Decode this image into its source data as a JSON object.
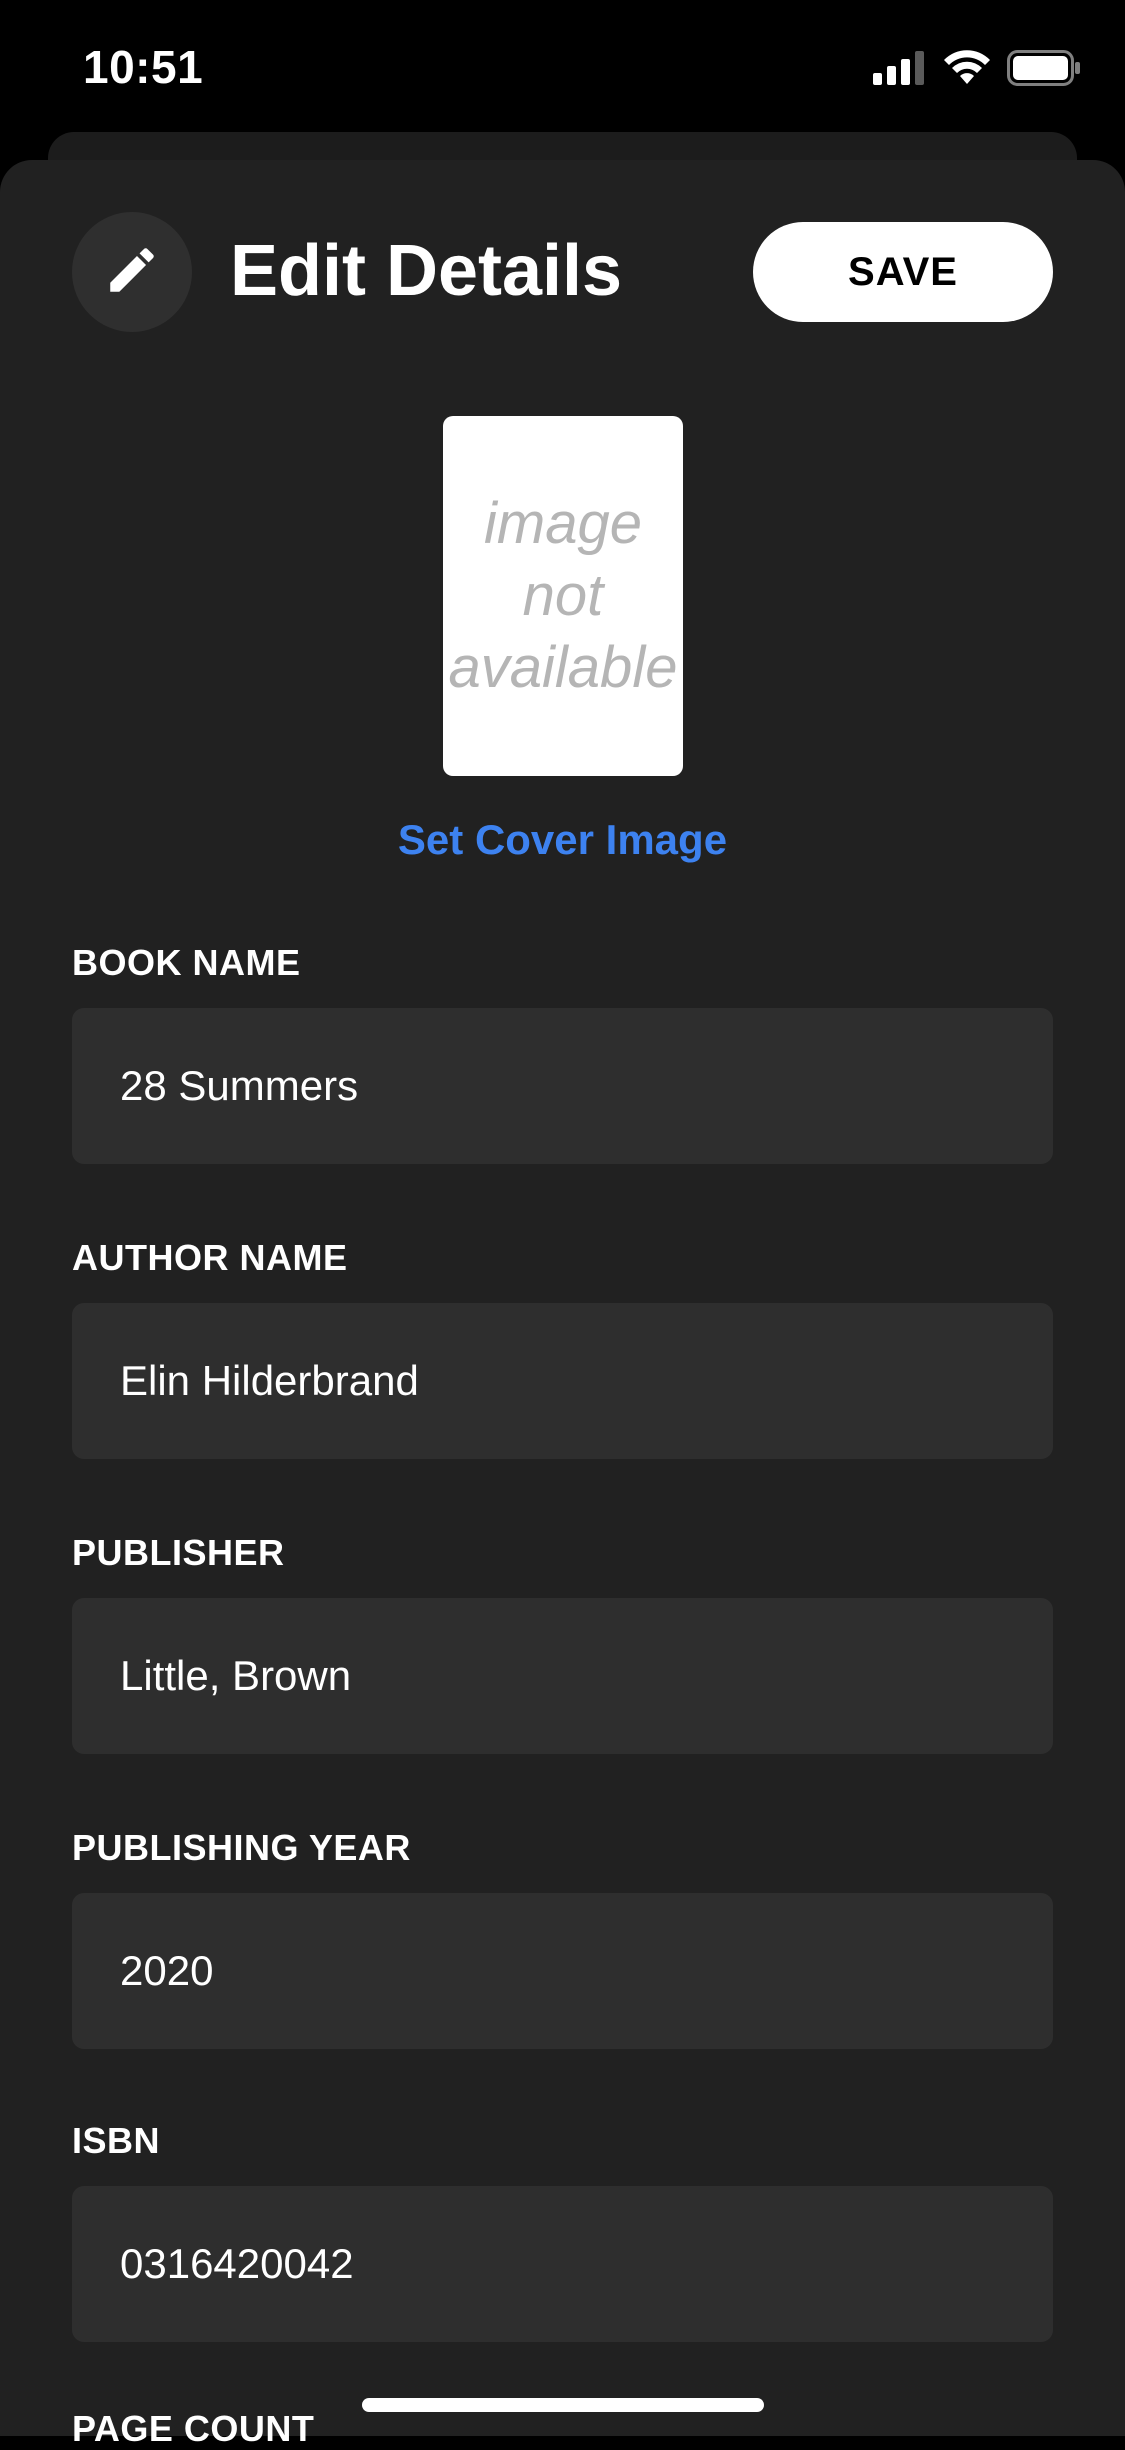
{
  "status_bar": {
    "time": "10:51",
    "icons": [
      "signal-icon",
      "wifi-icon",
      "battery-icon"
    ]
  },
  "header": {
    "edit_icon": "pencil-icon",
    "title": "Edit Details",
    "save_label": "SAVE"
  },
  "cover": {
    "placeholder_text": "image not available",
    "set_cover_label": "Set Cover Image"
  },
  "fields": [
    {
      "label": "BOOK NAME",
      "value": "28 Summers"
    },
    {
      "label": "AUTHOR NAME",
      "value": "Elin Hilderbrand"
    },
    {
      "label": "PUBLISHER",
      "value": "Little, Brown"
    },
    {
      "label": "PUBLISHING YEAR",
      "value": "2020"
    },
    {
      "label": "ISBN",
      "value": "0316420042"
    },
    {
      "label": "PAGE COUNT",
      "value": ""
    }
  ],
  "colors": {
    "background": "#000000",
    "sheet": "#212121",
    "field": "#2e2e2e",
    "link": "#3d82f0",
    "save_button_bg": "#ffffff"
  }
}
